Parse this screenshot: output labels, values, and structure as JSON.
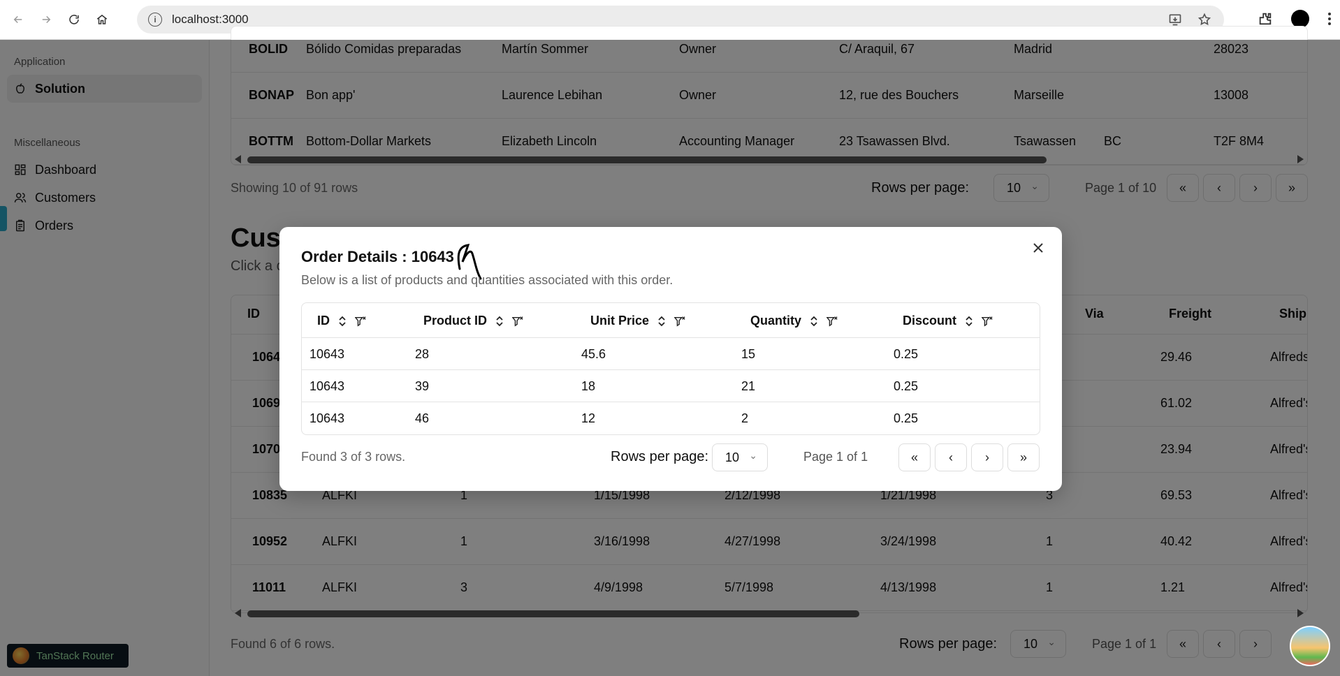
{
  "browser": {
    "url": "localhost:3000"
  },
  "sidebar": {
    "groups": [
      {
        "label": "Application",
        "items": [
          {
            "label": "Solution",
            "active": true
          }
        ]
      },
      {
        "label": "Miscellaneous",
        "items": [
          {
            "label": "Dashboard"
          },
          {
            "label": "Customers"
          },
          {
            "label": "Orders"
          }
        ]
      }
    ],
    "badge": "TanStack Router"
  },
  "customers_table": {
    "rows": [
      [
        "BOLID",
        "Bólido Comidas preparadas",
        "Martín Sommer",
        "Owner",
        "C/ Araquil, 67",
        "Madrid",
        "",
        "28023"
      ],
      [
        "BONAP",
        "Bon app'",
        "Laurence Lebihan",
        "Owner",
        "12, rue des Bouchers",
        "Marseille",
        "",
        "13008"
      ],
      [
        "BOTTM",
        "Bottom-Dollar Markets",
        "Elizabeth Lincoln",
        "Accounting Manager",
        "23 Tsawassen Blvd.",
        "Tsawassen",
        "BC",
        "T2F 8M4"
      ]
    ],
    "footer": {
      "showing": "Showing 10 of 91 rows",
      "rows_per_page_label": "Rows per page:",
      "rows_per_page": "10",
      "page": "Page 1 of 10"
    }
  },
  "orders_section": {
    "title": "Cust",
    "subtitle": "Click a c",
    "headers": [
      "ID",
      "Via",
      "Freight",
      "Ship Nan"
    ],
    "rows": [
      [
        "1064",
        "",
        "",
        "",
        "",
        "",
        "",
        "29.46",
        "Alfreds Fut"
      ],
      [
        "1069",
        "",
        "",
        "",
        "",
        "",
        "",
        "61.02",
        "Alfred's Fu"
      ],
      [
        "1070",
        "",
        "",
        "",
        "",
        "",
        "",
        "23.94",
        "Alfred's Fu"
      ],
      [
        "10835",
        "ALFKI",
        "1",
        "1/15/1998",
        "2/12/1998",
        "1/21/1998",
        "3",
        "69.53",
        "Alfred's Fu"
      ],
      [
        "10952",
        "ALFKI",
        "1",
        "3/16/1998",
        "4/27/1998",
        "3/24/1998",
        "1",
        "40.42",
        "Alfred's Fu"
      ],
      [
        "11011",
        "ALFKI",
        "3",
        "4/9/1998",
        "5/7/1998",
        "4/13/1998",
        "1",
        "1.21",
        "Alfred's Fu"
      ]
    ],
    "footer": {
      "found": "Found 6 of 6 rows.",
      "rows_per_page_label": "Rows per page:",
      "rows_per_page": "10",
      "page": "Page 1 of 1"
    }
  },
  "modal": {
    "title": "Order Details : 10643",
    "description": "Below is a list of products and quantities associated with this order.",
    "columns": [
      "ID",
      "Product ID",
      "Unit Price",
      "Quantity",
      "Discount"
    ],
    "rows": [
      [
        "10643",
        "28",
        "45.6",
        "15",
        "0.25"
      ],
      [
        "10643",
        "39",
        "18",
        "21",
        "0.25"
      ],
      [
        "10643",
        "46",
        "12",
        "2",
        "0.25"
      ]
    ],
    "footer": {
      "found": "Found 3 of 3 rows.",
      "rows_per_page_label": "Rows per page:",
      "rows_per_page": "10",
      "page": "Page 1 of 1"
    },
    "pager_buttons": [
      "«",
      "‹",
      "›",
      "»"
    ]
  },
  "pager_symbols": {
    "first": "«",
    "prev": "‹",
    "next": "›",
    "last": "»",
    "chevron": "⌄"
  },
  "colors": {
    "overlay": "#00000080",
    "accent": "#2aa9c9"
  }
}
